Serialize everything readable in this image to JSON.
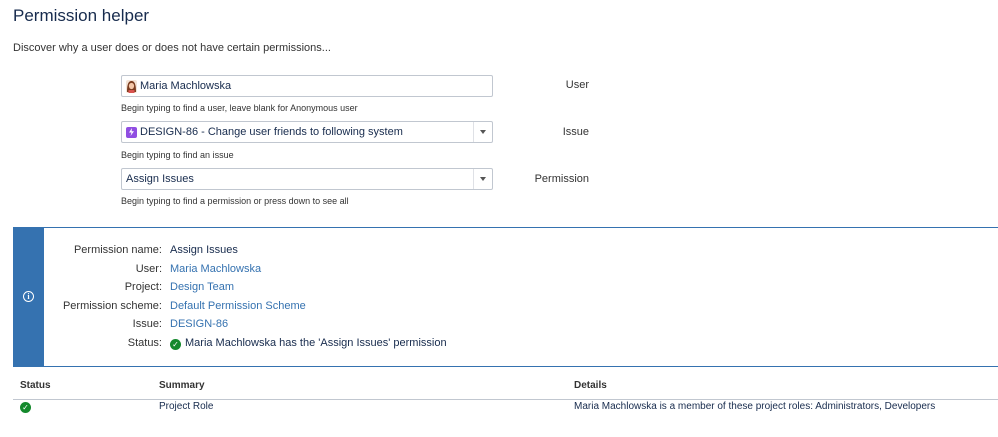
{
  "page": {
    "title": "Permission helper",
    "description": "Discover why a user does or does not have certain permissions..."
  },
  "form": {
    "user": {
      "label": "User",
      "value": "Maria Machlowska",
      "help": "Begin typing to find a user, leave blank for Anonymous user",
      "icon": "user-avatar-icon"
    },
    "issue": {
      "label": "Issue",
      "value": "DESIGN-86 - Change user friends to following system",
      "help": "Begin typing to find an issue",
      "icon": "story-icon"
    },
    "permission": {
      "label": "Permission",
      "value": "Assign Issues",
      "help": "Begin typing to find a permission or press down to see all"
    }
  },
  "result": {
    "accent": "#3572b0",
    "rows": [
      {
        "key": "Permission name:",
        "value": "Assign Issues"
      },
      {
        "key": "User:",
        "value": "Maria Machlowska"
      },
      {
        "key": "Project:",
        "value": "Design Team"
      },
      {
        "key": "Permission scheme:",
        "value": "Default Permission Scheme"
      },
      {
        "key": "Issue:",
        "value": "DESIGN-86"
      },
      {
        "key": "Status:",
        "value": "Maria Machlowska has the 'Assign Issues' permission"
      }
    ]
  },
  "table": {
    "headers": [
      "Status",
      "Summary",
      "Details"
    ],
    "rows": [
      {
        "status_icon": "success-check-icon",
        "summary": "Project Role",
        "details": "Maria Machlowska is a member of these project roles: Administrators, Developers"
      }
    ]
  },
  "colors": {
    "link": "#3572b0",
    "success": "#14892c",
    "story": "#904ee2"
  }
}
